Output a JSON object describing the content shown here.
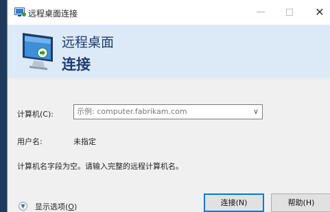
{
  "window": {
    "title": "远程桌面连接",
    "minimize_icon": "minimize-icon",
    "maximize_icon": "maximize-icon",
    "close_icon": "close-icon"
  },
  "banner": {
    "line1": "远程桌面",
    "line2": "连接",
    "icon": "remote-desktop-monitor-icon"
  },
  "form": {
    "computer_label": "计算机(C):",
    "computer_placeholder": "示例: computer.fabrikam.com",
    "username_label": "用户名:",
    "username_value": "未指定",
    "message": "计算机名字段为空。请输入完整的远程计算机名。"
  },
  "footer": {
    "show_options": "显示选项(O)",
    "show_options_underline": "O",
    "connect_button": "连接(N)",
    "help_button": "帮助(H)"
  },
  "colors": {
    "banner_bg": "#dce9f7",
    "banner_text": "#1f3b73",
    "primary_border": "#0078d7"
  }
}
